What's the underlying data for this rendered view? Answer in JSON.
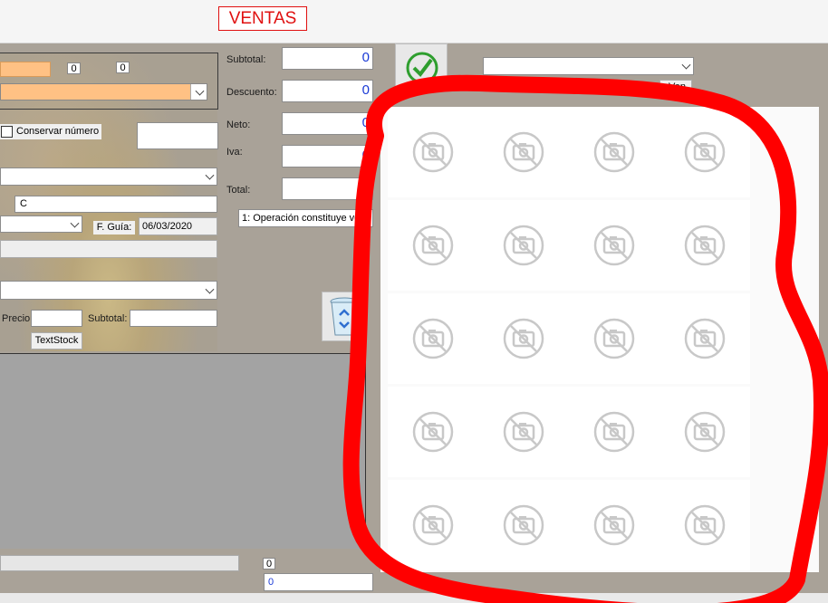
{
  "window": {
    "title": "VENTAS"
  },
  "customer": {
    "code_value": "0",
    "extra_value": "0",
    "conservar_label": "Conservar número",
    "field_c_value": "C"
  },
  "guia": {
    "label": "F. Guía:",
    "date": "06/03/2020"
  },
  "item": {
    "precio_label": "Precio:",
    "subtotal_label": "Subtotal:",
    "stock_button": "TextStock"
  },
  "totals": {
    "subtotal_label": "Subtotal:",
    "subtotal_value": "0",
    "descuento_label": "Descuento:",
    "descuento_value": "0",
    "neto_label": "Neto:",
    "neto_value": "0",
    "iva_label": "Iva:",
    "iva_value": "0",
    "total_label": "Total:",
    "total_value": "0",
    "operation_select": "1: Operación constituye ve"
  },
  "right": {
    "partial_button": ":Ven"
  },
  "footer": {
    "count_value": "0",
    "bottom_value": "0"
  },
  "gallery": {
    "icon": "image-unavailable-icon",
    "cells": [
      "image-unavailable",
      "image-unavailable",
      "image-unavailable",
      "image-unavailable",
      "image-unavailable",
      "image-unavailable",
      "image-unavailable",
      "image-unavailable",
      "image-unavailable",
      "image-unavailable",
      "image-unavailable",
      "image-unavailable",
      "image-unavailable",
      "image-unavailable",
      "image-unavailable",
      "image-unavailable",
      "image-unavailable",
      "image-unavailable",
      "image-unavailable",
      "image-unavailable"
    ]
  },
  "colors": {
    "accent_orange": "#ffc184",
    "total_red": "#e21a1a",
    "value_blue": "#1a3ad6",
    "annotation_red": "#ff0000"
  }
}
